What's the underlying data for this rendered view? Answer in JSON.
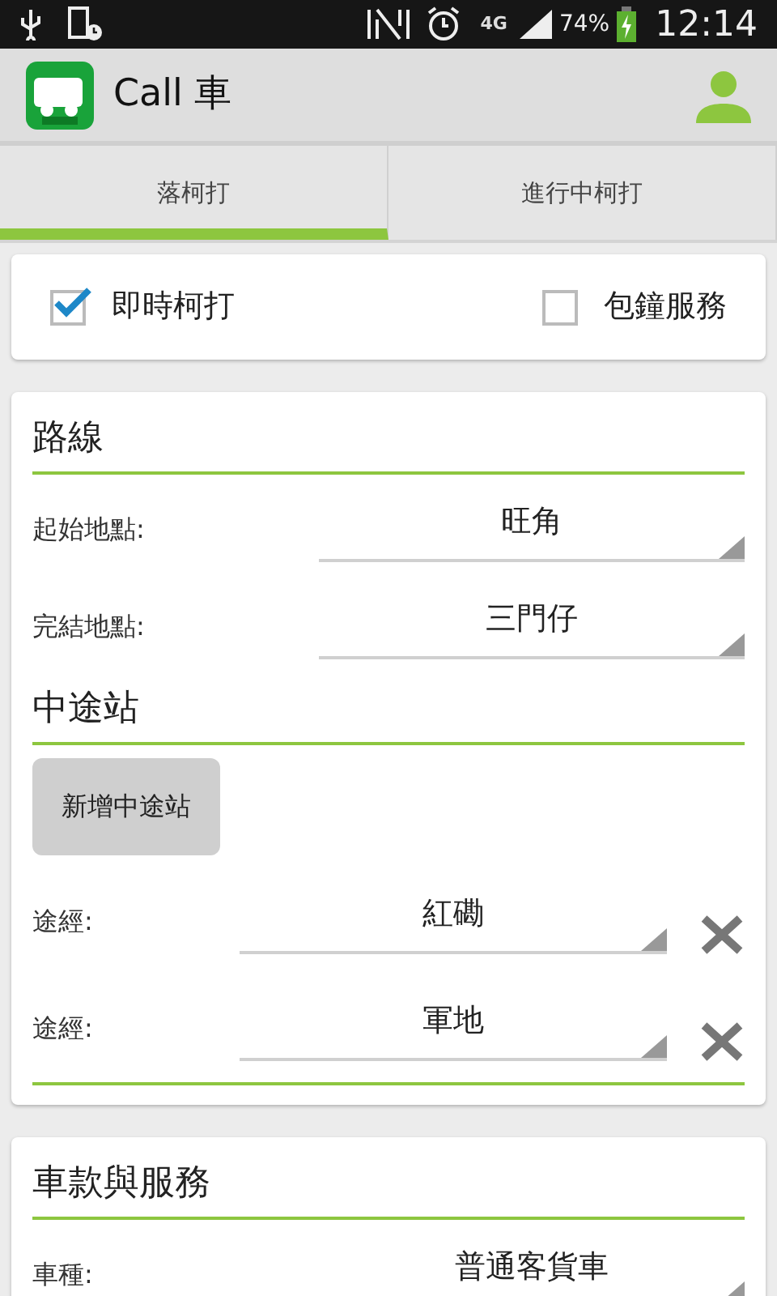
{
  "status_bar": {
    "network": "4G",
    "battery": "74%",
    "time": "12:14"
  },
  "app_bar": {
    "title": "Call 車"
  },
  "tabs": [
    {
      "label": "落柯打",
      "selected": true
    },
    {
      "label": "進行中柯打",
      "selected": false
    }
  ],
  "options": [
    {
      "label": "即時柯打",
      "checked": true
    },
    {
      "label": "包鐘服務",
      "checked": false
    }
  ],
  "route": {
    "title": "路線",
    "fields": [
      {
        "label": "起始地點:",
        "value": "旺角"
      },
      {
        "label": "完結地點:",
        "value": "三門仔"
      }
    ]
  },
  "stops": {
    "title": "中途站",
    "add_button": "新增中途站",
    "items": [
      {
        "label": "途經:",
        "value": "紅磡"
      },
      {
        "label": "途經:",
        "value": "軍地"
      }
    ]
  },
  "vehicle": {
    "title": "車款與服務",
    "fields": [
      {
        "label": "車種:",
        "value": "普通客貨車"
      }
    ]
  }
}
